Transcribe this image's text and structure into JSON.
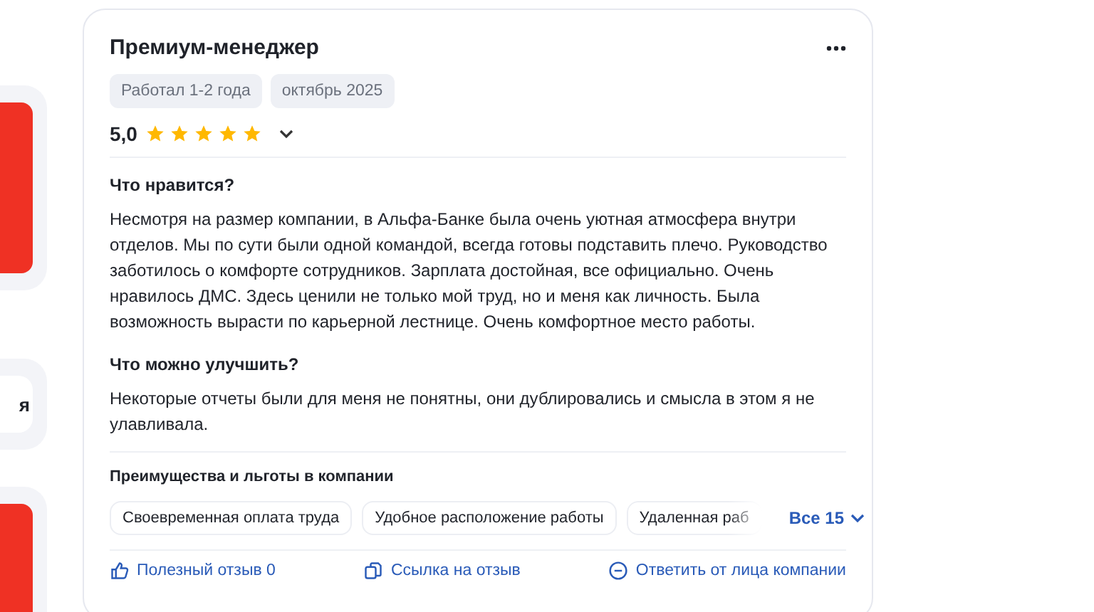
{
  "sidebar": {
    "card_text": "я"
  },
  "review": {
    "title": "Премиум-менеджер",
    "tags": [
      "Работал 1-2 года",
      "октябрь 2025"
    ],
    "rating": "5,0",
    "stars": 5,
    "sections": [
      {
        "heading": "Что нравится?",
        "text": "Несмотря на размер компании, в Альфа-Банке была очень уютная атмосфера внутри отделов. Мы по сути были одной командой, всегда готовы подставить плечо. Руководство заботилось о комфорте сотрудников. Зарплата достойная, все официально. Очень нравилось ДМС. Здесь ценили не только мой труд, но и меня как личность. Была возможность вырасти по карьерной лестнице. Очень комфортное место работы."
      },
      {
        "heading": "Что можно улучшить?",
        "text": "Некоторые отчеты были для меня не понятны, они дублировались и смысла в этом я не улавливала."
      }
    ],
    "benefits": {
      "heading": "Преимущества и льготы в компании",
      "items": [
        "Своевременная оплата труда",
        "Удобное расположение работы",
        "Удаленная раб"
      ],
      "more": "Все 15"
    },
    "actions": [
      {
        "kind": "like",
        "label": "Полезный отзыв 0"
      },
      {
        "kind": "link",
        "label": "Ссылка на отзыв"
      },
      {
        "kind": "reply",
        "label": "Ответить от лица компании"
      }
    ]
  }
}
